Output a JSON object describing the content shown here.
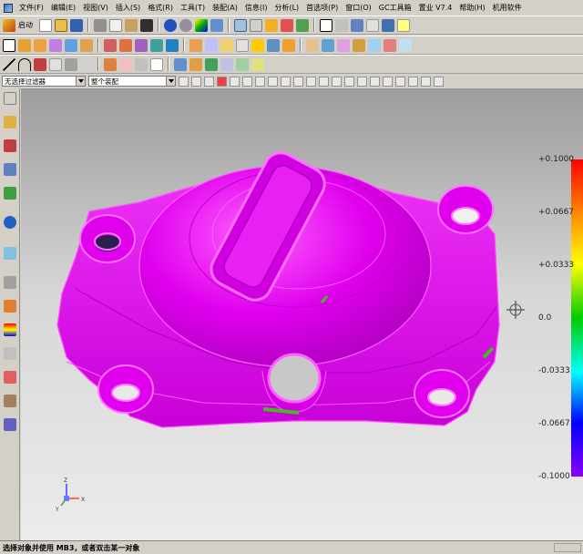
{
  "menu": {
    "items": [
      "文件(F)",
      "编辑(E)",
      "视图(V)",
      "插入(S)",
      "格式(R)",
      "工具(T)",
      "装配(A)",
      "信息(I)",
      "分析(L)",
      "首选项(P)",
      "窗口(O)",
      "GC工具箱",
      "置业 V7.4",
      "帮助(H)",
      "机用软件"
    ]
  },
  "toolbar": {
    "start_label": "启动"
  },
  "filterbar": {
    "selection_filter": "无选择过滤器",
    "assembly_scope": "整个装配"
  },
  "colorscale": {
    "labels": [
      "+0.1000",
      "+0.0667",
      "+0.0333",
      "0.0",
      "-0.0333",
      "-0.0667",
      "-0.1000"
    ],
    "colors": [
      "#ff0000",
      "#ff8800",
      "#ffff00",
      "#00cc00",
      "#00ffff",
      "#0000ff",
      "#8800ff"
    ]
  },
  "triad": {
    "x": "X",
    "y": "Y",
    "z": "Z"
  },
  "model": {
    "main_color": "#e000ee",
    "edge_color": "#ff40ff",
    "dark_color": "#b000c0",
    "accent_color": "#44bb22"
  },
  "status": {
    "message": "选择对象并使用 MB3，或者双击某一对象"
  }
}
